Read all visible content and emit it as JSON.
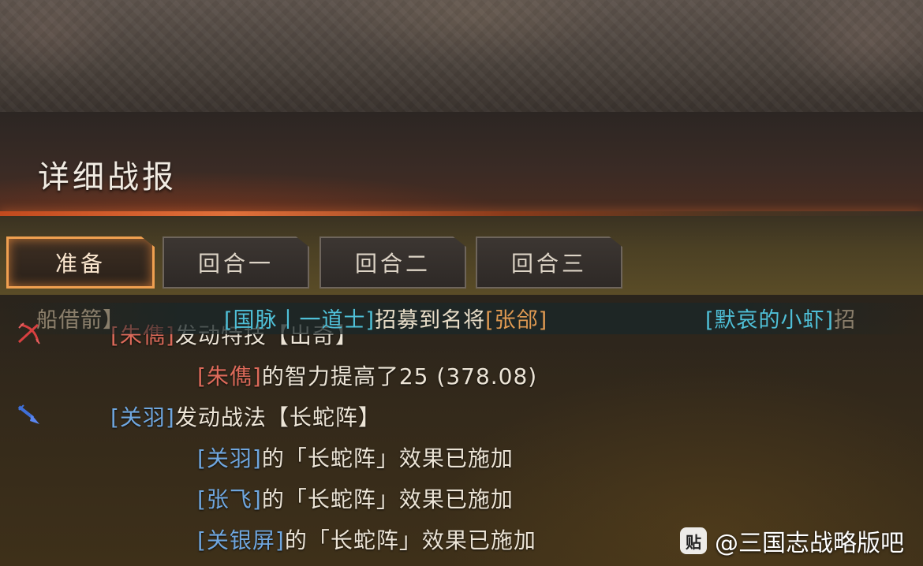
{
  "window": {
    "title": "详细战报"
  },
  "tabs": [
    {
      "label": "准备",
      "active": true
    },
    {
      "label": "回合一",
      "active": false
    },
    {
      "label": "回合二",
      "active": false
    },
    {
      "label": "回合三",
      "active": false
    }
  ],
  "ticker": {
    "left_fragment": "船借箭】",
    "seg1_name": "[国脉丨一道士]",
    "seg1_text": "招募到名将",
    "seg1_target": "[张郃]",
    "seg2_name": "[默哀的小虾]",
    "seg2_text": "招"
  },
  "log": {
    "line1": {
      "actor": "[朱儁]",
      "text": "发动特技【出奇】"
    },
    "line2": {
      "actor": "[朱儁]",
      "text": "的智力提高了25 (378.08)"
    },
    "line3": {
      "actor": "[关羽]",
      "text": "发动战法【长蛇阵】"
    },
    "line4": {
      "actor": "[关羽]",
      "text": "的「长蛇阵」效果已施加"
    },
    "line5": {
      "actor": "[张飞]",
      "text": "的「长蛇阵」效果已施加"
    },
    "line6": {
      "actor": "[关银屏]",
      "text": "的「长蛇阵」效果已施加"
    }
  },
  "icons": {
    "line1_icon": "crossed-bow-icon",
    "line3_icon": "blue-spear-icon"
  },
  "watermark": {
    "logo": "贴",
    "text": "@三国志战略版吧"
  },
  "colors": {
    "enemy_name": "#dd6a5a",
    "ally_name": "#6fa6de",
    "player_name": "#4fc0d8",
    "general_name": "#e09a52",
    "tab_active_border": "#f0a050"
  }
}
